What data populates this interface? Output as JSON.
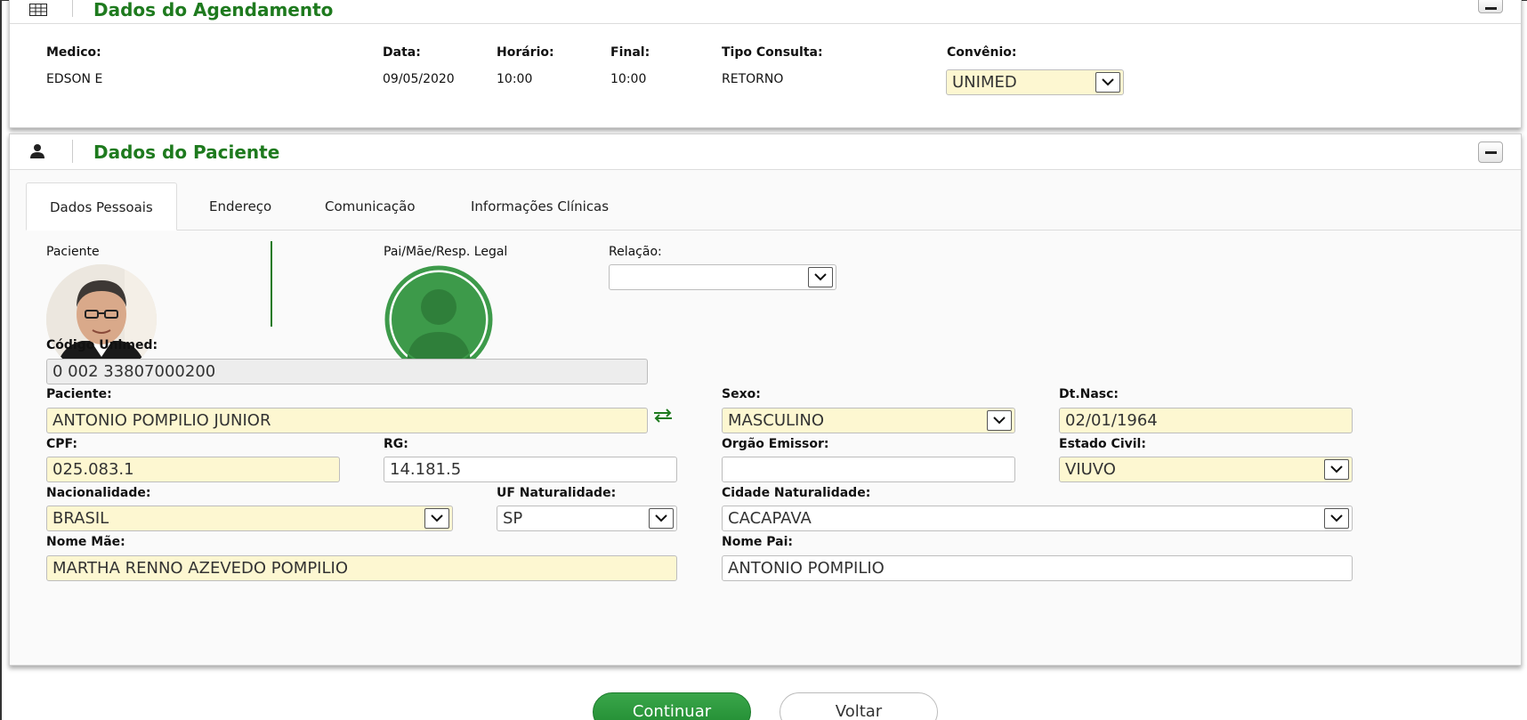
{
  "agendamento": {
    "title": "Dados do Agendamento",
    "medico_label": "Medico:",
    "medico_value": "EDSON E",
    "data_label": "Data:",
    "data_value": "09/05/2020",
    "horario_label": "Horário:",
    "horario_value": "10:00",
    "final_label": "Final:",
    "final_value": "10:00",
    "tipo_label": "Tipo Consulta:",
    "tipo_value": "RETORNO",
    "convenio_label": "Convênio:",
    "convenio_value": "UNIMED"
  },
  "paciente": {
    "title": "Dados do Paciente",
    "tabs": [
      {
        "label": "Dados Pessoais",
        "active": true
      },
      {
        "label": "Endereço",
        "active": false
      },
      {
        "label": "Comunicação",
        "active": false
      },
      {
        "label": "Informações Clínicas",
        "active": false
      }
    ],
    "paciente_photo_label": "Paciente",
    "resp_label": "Pai/Mãe/Resp. Legal",
    "relacao_label": "Relação:",
    "relacao_value": "",
    "codigo_label": "Código Unimed:",
    "codigo_value": "0 002 33807000200",
    "nome_label": "Paciente:",
    "nome_value": "ANTONIO POMPILIO JUNIOR",
    "sexo_label": "Sexo:",
    "sexo_value": "MASCULINO",
    "dtnasc_label": "Dt.Nasc:",
    "dtnasc_value": "02/01/1964",
    "cpf_label": "CPF:",
    "cpf_value": "025.083.1",
    "rg_label": "RG:",
    "rg_value": "14.181.5",
    "orgao_label": "Orgão Emissor:",
    "orgao_value": "",
    "estado_civil_label": "Estado Civil:",
    "estado_civil_value": "VIUVO",
    "nacionalidade_label": "Nacionalidade:",
    "nacionalidade_value": "BRASIL",
    "uf_label": "UF Naturalidade:",
    "uf_value": "SP",
    "cidade_label": "Cidade Naturalidade:",
    "cidade_value": "CACAPAVA",
    "mae_label": "Nome Mãe:",
    "mae_value": "MARTHA RENNO AZEVEDO POMPILIO",
    "pai_label": "Nome Pai:",
    "pai_value": "ANTONIO POMPILIO"
  },
  "actions": {
    "continuar": "Continuar",
    "voltar": "Voltar"
  },
  "colors": {
    "accent_green": "#1e7a1e",
    "highlight_field": "#fdf7d1"
  }
}
